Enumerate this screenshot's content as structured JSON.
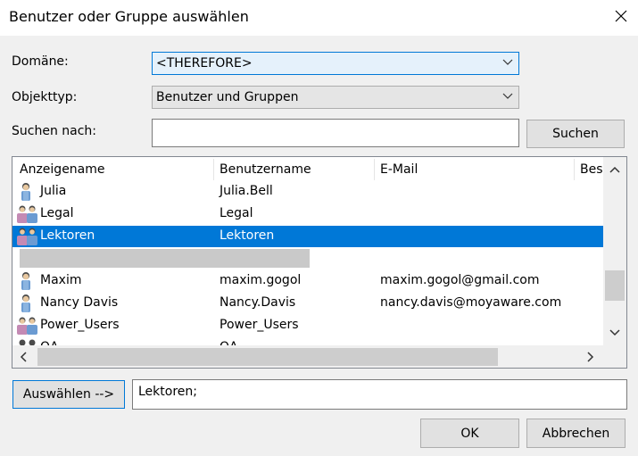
{
  "dialog": {
    "title": "Benutzer oder Gruppe auswählen"
  },
  "domain": {
    "label": "Domäne:",
    "value": "<THEREFORE>"
  },
  "object_type": {
    "label": "Objekttyp:",
    "value": "Benutzer und Gruppen"
  },
  "search": {
    "label": "Suchen nach:",
    "value": "",
    "button": "Suchen"
  },
  "columns": [
    "Anzeigename",
    "Benutzername",
    "E-Mail",
    "Bes"
  ],
  "rows": [
    {
      "name": "Julia",
      "user": "Julia.Bell",
      "email": "",
      "icon": "user-icon"
    },
    {
      "name": "Legal",
      "user": "Legal",
      "email": "",
      "icon": "group-icon"
    },
    {
      "name": "Lektoren",
      "user": "Lektoren",
      "email": "",
      "icon": "group-icon",
      "selected": true
    },
    {
      "name": "",
      "user": "",
      "email": "",
      "icon": "",
      "redacted": true
    },
    {
      "name": "Maxim",
      "user": "maxim.gogol",
      "email": "maxim.gogol@gmail.com",
      "icon": "user-icon"
    },
    {
      "name": "Nancy Davis",
      "user": "Nancy.Davis",
      "email": "nancy.davis@moyaware.com",
      "icon": "user-icon"
    },
    {
      "name": "Power_Users",
      "user": "Power_Users",
      "email": "",
      "icon": "group-icon"
    },
    {
      "name": "QA",
      "user": "QA",
      "email": "",
      "icon": "group-icon"
    }
  ],
  "selection": {
    "button": "Auswählen -->",
    "value": "Lektoren;"
  },
  "footer": {
    "ok": "OK",
    "cancel": "Abbrechen"
  },
  "colors": {
    "accent": "#0078d7",
    "selected_row": "#0078d7",
    "background": "#f0f0f0"
  }
}
